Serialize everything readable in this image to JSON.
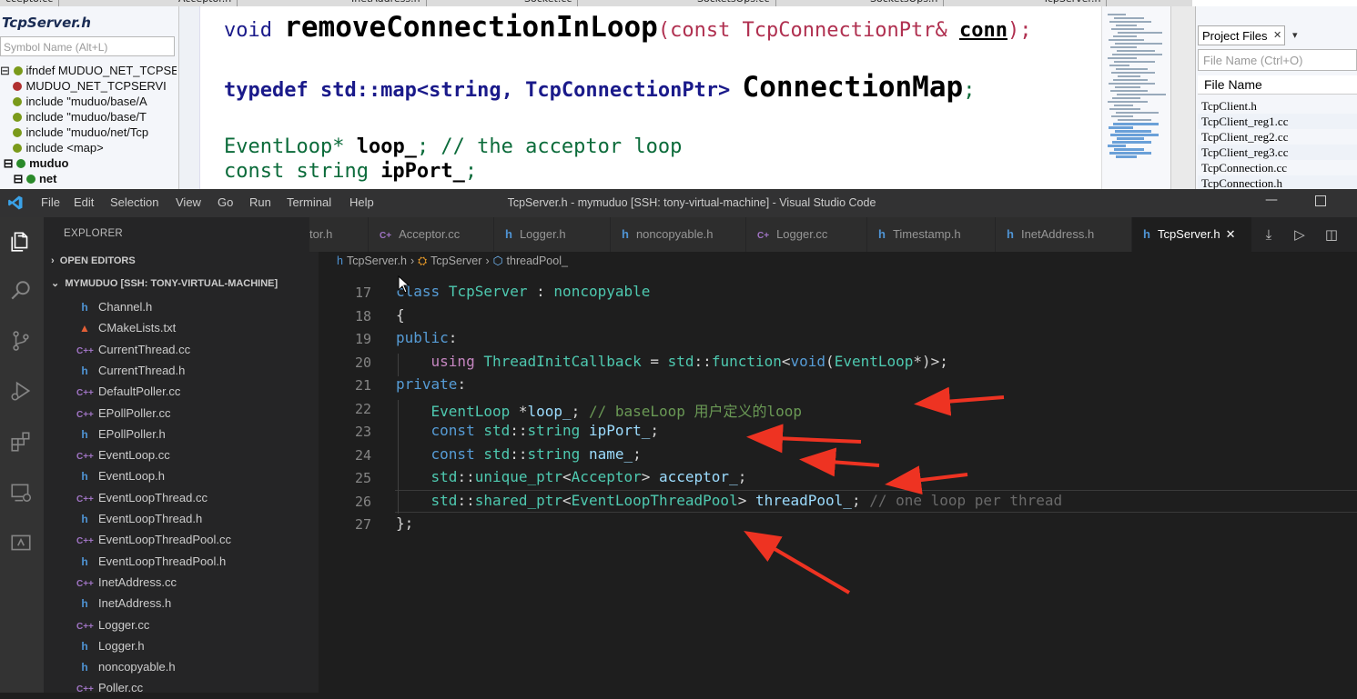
{
  "source_insight": {
    "top_tabs": [
      "ccepto.cc",
      "Acceptor.h",
      "InetAddress.h",
      "Socket.cc",
      "SocketsOps.cc",
      "SocketsOps.h",
      "TcpServer.h"
    ],
    "file_title": "TcpServer.h",
    "symbol_search_placeholder": "Symbol Name (Alt+L)",
    "symbols": [
      {
        "label": "ifndef MUDUO_NET_TCPSE",
        "color": "#7a9a1a",
        "prefix": "⊟ "
      },
      {
        "label": "MUDUO_NET_TCPSERVI",
        "color": "#b03030",
        "prefix": "    "
      },
      {
        "label": "include \"muduo/base/A",
        "color": "#7a9a1a",
        "prefix": "    "
      },
      {
        "label": "include \"muduo/base/T",
        "color": "#7a9a1a",
        "prefix": "    "
      },
      {
        "label": "include \"muduo/net/Tcp",
        "color": "#7a9a1a",
        "prefix": "    "
      },
      {
        "label": "include <map>",
        "color": "#7a9a1a",
        "prefix": "    "
      },
      {
        "label": "muduo",
        "color": "#2a8a2a",
        "prefix": " ⊟ "
      },
      {
        "label": "net",
        "color": "#2a8a2a",
        "prefix": "    ⊟ "
      }
    ],
    "code_lines": [
      {
        "pre": "void ",
        "big": "removeConnectionInLoop",
        "post": "(const TcpConnectionPtr& ",
        "bold": "conn",
        "end": ");"
      },
      {
        "pre": "typedef std::map<string, TcpConnectionPtr> ",
        "big": "ConnectionMap",
        "post": "",
        "bold": "",
        "end": ";"
      },
      {
        "pre": "EventLoop* ",
        "big": "",
        "post": "",
        "bold": "loop_",
        "end": ";  // the acceptor loop"
      },
      {
        "pre": "const string ",
        "big": "",
        "post": "",
        "bold": "ipPort_",
        "end": ";"
      }
    ],
    "project_files_tab": "Project Files",
    "file_search_placeholder": "File Name (Ctrl+O)",
    "file_list_header": "File Name",
    "project_files": [
      "TcpClient.h",
      "TcpClient_reg1.cc",
      "TcpClient_reg2.cc",
      "TcpClient_reg3.cc",
      "TcpConnection.cc",
      "TcpConnection.h"
    ]
  },
  "vscode": {
    "menu": [
      "File",
      "Edit",
      "Selection",
      "View",
      "Go",
      "Run",
      "Terminal",
      "Help"
    ],
    "window_title": "TcpServer.h - mymuduo [SSH: tony-virtual-machine] - Visual Studio Code",
    "explorer_title": "EXPLORER",
    "open_editors": "OPEN EDITORS",
    "workspace": "MYMUDUO [SSH: TONY-VIRTUAL-MACHINE]",
    "files": [
      {
        "name": "Channel.h",
        "kind": "h"
      },
      {
        "name": "CMakeLists.txt",
        "kind": "cmake"
      },
      {
        "name": "CurrentThread.cc",
        "kind": "cc"
      },
      {
        "name": "CurrentThread.h",
        "kind": "h"
      },
      {
        "name": "DefaultPoller.cc",
        "kind": "cc"
      },
      {
        "name": "EPollPoller.cc",
        "kind": "cc"
      },
      {
        "name": "EPollPoller.h",
        "kind": "h"
      },
      {
        "name": "EventLoop.cc",
        "kind": "cc"
      },
      {
        "name": "EventLoop.h",
        "kind": "h"
      },
      {
        "name": "EventLoopThread.cc",
        "kind": "cc"
      },
      {
        "name": "EventLoopThread.h",
        "kind": "h"
      },
      {
        "name": "EventLoopThreadPool.cc",
        "kind": "cc"
      },
      {
        "name": "EventLoopThreadPool.h",
        "kind": "h"
      },
      {
        "name": "InetAddress.cc",
        "kind": "cc"
      },
      {
        "name": "InetAddress.h",
        "kind": "h"
      },
      {
        "name": "Logger.cc",
        "kind": "cc"
      },
      {
        "name": "Logger.h",
        "kind": "h"
      },
      {
        "name": "noncopyable.h",
        "kind": "h"
      },
      {
        "name": "Poller.cc",
        "kind": "cc"
      }
    ],
    "tabs": [
      {
        "label": "tor.h",
        "kind": "none"
      },
      {
        "label": "Acceptor.cc",
        "kind": "cc"
      },
      {
        "label": "Logger.h",
        "kind": "h"
      },
      {
        "label": "noncopyable.h",
        "kind": "h"
      },
      {
        "label": "Logger.cc",
        "kind": "cc"
      },
      {
        "label": "Timestamp.h",
        "kind": "h"
      },
      {
        "label": "InetAddress.h",
        "kind": "h"
      },
      {
        "label": "TcpServer.h",
        "kind": "h",
        "active": true
      }
    ],
    "breadcrumb": [
      "TcpServer.h",
      "TcpServer",
      "threadPool_"
    ],
    "code": [
      {
        "num": "17",
        "html": "<span class='kw2'>class</span> <span class='ty'>TcpServer</span> : <span class='ty'>noncopyable</span>"
      },
      {
        "num": "18",
        "html": "{"
      },
      {
        "num": "19",
        "html": "<span class='kw2'>public</span>:"
      },
      {
        "num": "20",
        "html": "    <span class='kw'>using</span> <span class='ty'>ThreadInitCallback</span> = <span class='ty'>std</span>::<span class='ty'>function</span>&lt;<span class='kw2'>void</span>(<span class='ty'>EventLoop</span>*)&gt;;"
      },
      {
        "num": "21",
        "html": "<span class='kw2'>private</span>:"
      },
      {
        "num": "22",
        "html": "    <span class='ty'>EventLoop</span> *<span class='va'>loop_</span>; <span class='cm'>// baseLoop 用户定义的loop</span>"
      },
      {
        "num": "23",
        "html": "    <span class='kw2'>const</span> <span class='ty'>std</span>::<span class='ty'>string</span> <span class='va'>ipPort_</span>;"
      },
      {
        "num": "24",
        "html": "    <span class='kw2'>const</span> <span class='ty'>std</span>::<span class='ty'>string</span> <span class='va'>name_</span>;"
      },
      {
        "num": "25",
        "html": "    <span class='ty'>std</span>::<span class='ty'>unique_ptr</span>&lt;<span class='ty'>Acceptor</span>&gt; <span class='va'>acceptor_</span>;"
      },
      {
        "num": "26",
        "html": "    <span class='ty'>std</span>::<span class='ty'>shared_ptr</span>&lt;<span class='ty'>EventLoopThreadPool</span>&gt; <span class='va'>threadPool_</span>; <span class='dim'>// one loop per thread</span>"
      },
      {
        "num": "27",
        "html": "};"
      }
    ]
  },
  "colors": {
    "annotation_arrow": "#ee3322",
    "vscode_accent": "#007acc"
  }
}
